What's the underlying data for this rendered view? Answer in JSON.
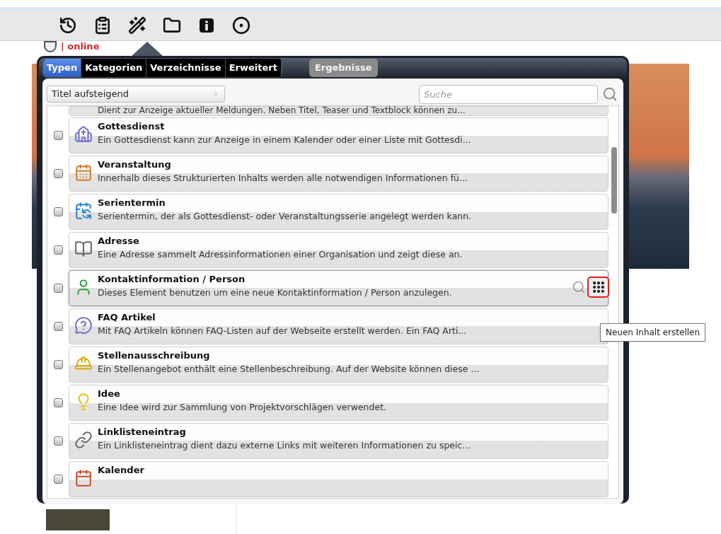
{
  "logo": {
    "text": "| online"
  },
  "popup": {
    "tabs": [
      {
        "label": "Typen",
        "selected": true
      },
      {
        "label": "Kategorien",
        "selected": false
      },
      {
        "label": "Verzeichnisse",
        "selected": false
      },
      {
        "label": "Erweitert",
        "selected": false
      }
    ],
    "results_button": {
      "label": "Ergebnisse",
      "disabled": true
    },
    "sort": {
      "value": "Titel aufsteigend"
    },
    "search": {
      "placeholder": "Suche"
    },
    "items": [
      {
        "kind": "partial",
        "description": "Dient zur Anzeige aktueller Meldungen. Neben Titel, Teaser und Textblock können zu..."
      },
      {
        "kind": "full",
        "title": "Gottesdienst",
        "description": "Ein Gottesdienst kann zur Anzeige in einem Kalender oder einer Liste mit Gottesdi...",
        "checked": false,
        "selected": false
      },
      {
        "kind": "full",
        "title": "Veranstaltung",
        "description": "Innerhalb dieses Strukturierten Inhalts werden alle notwendigen Informationen fü...",
        "checked": false,
        "selected": false
      },
      {
        "kind": "full",
        "title": "Serientermin",
        "description": "Serientermin, der als Gottesdienst- oder Veranstaltungsserie angelegt werden kann.",
        "checked": false,
        "selected": false
      },
      {
        "kind": "full",
        "title": "Adresse",
        "description": "Eine Adresse sammelt Adressinformationen einer Organisation und zeigt diese an.",
        "checked": false,
        "selected": false
      },
      {
        "kind": "full",
        "title": "Kontaktinformation / Person",
        "description": "Dieses Element benutzen um eine neue Kontaktinformation / Person anzulegen.",
        "checked": false,
        "selected": true
      },
      {
        "kind": "full",
        "title": "FAQ Artikel",
        "description": "Mit FAQ Artikeln können FAQ-Listen auf der Webseite erstellt werden. Ein FAQ Arti...",
        "checked": false,
        "selected": false
      },
      {
        "kind": "full",
        "title": "Stellenausschreibung",
        "description": "Ein Stellenangebot enthält eine Stellenbeschreibung. Auf der Website können diese ...",
        "checked": false,
        "selected": false
      },
      {
        "kind": "full",
        "title": "Idee",
        "description": "Eine Idee wird zur Sammlung von Projektvorschlägen verwendet.",
        "checked": false,
        "selected": false
      },
      {
        "kind": "full",
        "title": "Linklisteneintrag",
        "description": "Ein Linklisteneintrag dient dazu externe Links mit weiteren Informationen zu speic...",
        "checked": false,
        "selected": false
      },
      {
        "kind": "full",
        "title": "Kalender",
        "checked": false,
        "selected": false
      }
    ]
  },
  "tooltip": {
    "text": "Neuen Inhalt erstellen"
  }
}
